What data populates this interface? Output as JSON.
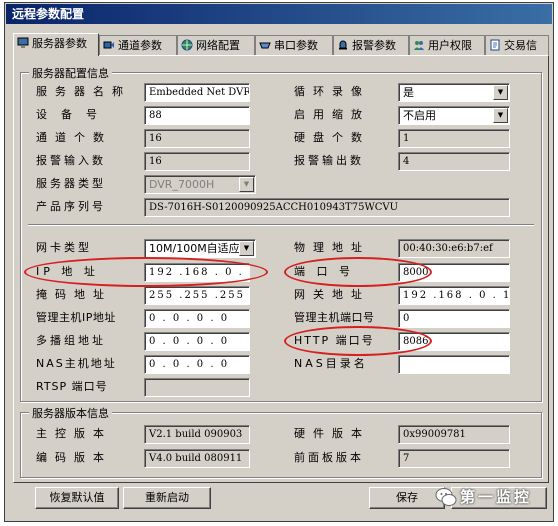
{
  "window": {
    "title": "远程参数配置"
  },
  "tabs": [
    {
      "label": "服务器参数"
    },
    {
      "label": "通道参数"
    },
    {
      "label": "网络配置"
    },
    {
      "label": "串口参数"
    },
    {
      "label": "报警参数"
    },
    {
      "label": "用户权限"
    },
    {
      "label": "交易信"
    }
  ],
  "server_info": {
    "title": "服务器配置信息",
    "name_label": "服务器名称",
    "name_value": "Embedded Net DVR",
    "loop_label": "循环录像",
    "loop_value": "是",
    "device_no_label": "设备号",
    "device_no_value": "88",
    "zoom_label": "启用缩放",
    "zoom_value": "不启用",
    "channels_label": "通道个数",
    "channels_value": "16",
    "disks_label": "硬盘个数",
    "disks_value": "1",
    "alarm_in_label": "报警输入数",
    "alarm_in_value": "16",
    "alarm_out_label": "报警输出数",
    "alarm_out_value": "4",
    "type_label": "服务器类型",
    "type_value": "DVR_7000H",
    "serial_label": "产品序列号",
    "serial_value": "DS-7016H-S0120090925ACCH010943T75WCVU",
    "nic_label": "网卡类型",
    "nic_value": "10M/100M自适应",
    "mac_label": "物理地址",
    "mac_value": "00:40:30:e6:b7:ef",
    "ip_label": "IP 地 址",
    "ip_value": "192 .168 . 0 . 64",
    "port_label": "端 口 号",
    "port_value": "8000",
    "mask_label": "掩码地址",
    "mask_value": "255 .255 .255 . 0",
    "gateway_label": "网关地址",
    "gateway_value": "192 .168 . 0 . 1",
    "mgr_ip_label": "管理主机IP地址",
    "mgr_ip_value": "0 . 0 . 0 . 0",
    "mgr_port_label": "管理主机端口号",
    "mgr_port_value": "0",
    "multicast_label": "多播组地址",
    "multicast_value": "0 . 0 . 0 . 0",
    "http_label": "HTTP 端口号",
    "http_value": "8086",
    "nas_label": "NAS主机地址",
    "nas_value": "0 . 0 . 0 . 0",
    "nas_dir_label": "NAS目录名",
    "nas_dir_value": "",
    "rtsp_label": "RTSP 端口号",
    "rtsp_value": ""
  },
  "version_info": {
    "title": "服务器版本信息",
    "main_label": "主控版本",
    "main_value": "V2.1 build 090903",
    "hw_label": "硬件版本",
    "hw_value": "0x99009781",
    "codec_label": "编码版本",
    "codec_value": "V4.0 build 080911",
    "front_label": "前面板版本",
    "front_value": "7"
  },
  "buttons": {
    "restore": "恢复默认值",
    "restart": "重新启动",
    "save": "保存"
  },
  "watermark": {
    "text": "第一监控"
  },
  "colors": {
    "title_bar": "#0a246a",
    "highlight": "#d42020",
    "face": "#d4d0c8"
  }
}
